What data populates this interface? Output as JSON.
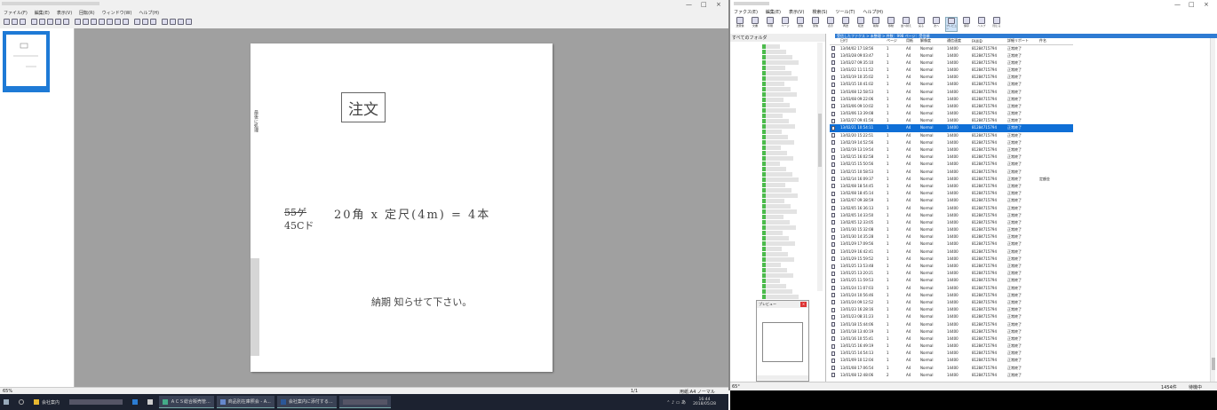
{
  "left_app": {
    "menu": [
      "ファイル(F)",
      "編集(E)",
      "表示(V)",
      "回転(R)",
      "ウィンドウ(W)",
      "ヘルプ(H)"
    ],
    "window_controls": [
      "—",
      "□",
      "×"
    ],
    "document": {
      "title": "注文",
      "side_note": "最後に処理",
      "struck": "55ゲ",
      "item": "45Cド",
      "line": "20角 x 定尺(4m) = 4本",
      "note": "納期 知らせて下さい。"
    },
    "status_zoom": "65%",
    "status_page": "1/1",
    "status_paper": "用紙:A4 ノーマル"
  },
  "taskbar": {
    "items": [
      {
        "label": "会社案内"
      },
      {
        "label": "ＡＣＳ総合販売管..."
      },
      {
        "label": "商品別在庫照会 - A..."
      },
      {
        "label": "会社案内に添付する..."
      }
    ],
    "time": "16:44",
    "date": "2018/05/28"
  },
  "right_app": {
    "menu": [
      "ファクス(E)",
      "編集(E)",
      "表示(V)",
      "検索(S)",
      "ツール(T)",
      "ヘルプ(H)"
    ],
    "window_controls": [
      "—",
      "□",
      "×"
    ],
    "toolbar": [
      "送受信",
      "文書",
      "印刷",
      "ページ",
      "送信",
      "受信",
      "表示",
      "再送",
      "転送",
      "削除",
      "移動",
      "並べ替え",
      "戻る",
      "次へ",
      "プレビュー",
      "保存",
      "ヘルプ",
      "閉じる"
    ],
    "tree_title": "すべてのフォルダ",
    "path": "受信したファクス > 未整理 > 件数：998 ページ：受信順",
    "preview_title": "プレビュー",
    "columns": [
      "日付",
      "ページ",
      "用紙",
      "解像度",
      "通信速度",
      "FAXID",
      "詳細リポート",
      "件名"
    ],
    "rows": [
      [
        "13/04/02 17:18:56",
        "1",
        "A4",
        "Normal",
        "14400",
        "81284715794",
        "正常終了",
        ""
      ],
      [
        "13/03/28 09:03:47",
        "1",
        "A4",
        "Normal",
        "14400",
        "81284715794",
        "正常終了",
        ""
      ],
      [
        "13/03/27 09:35:10",
        "1",
        "A4",
        "Normal",
        "14400",
        "81284715794",
        "正常終了",
        ""
      ],
      [
        "13/03/22 11:11:52",
        "1",
        "A4",
        "Normal",
        "14400",
        "81284715794",
        "正常終了",
        ""
      ],
      [
        "13/03/19 10:35:02",
        "1",
        "A4",
        "Normal",
        "14400",
        "81284715794",
        "正常終了",
        ""
      ],
      [
        "13/03/15 10:41:02",
        "1",
        "A4",
        "Normal",
        "14400",
        "81284715794",
        "正常終了",
        ""
      ],
      [
        "13/03/08 12:58:53",
        "1",
        "A4",
        "Normal",
        "14400",
        "81284715794",
        "正常終了",
        ""
      ],
      [
        "13/03/08 09:22:06",
        "1",
        "A4",
        "Normal",
        "14400",
        "81284715794",
        "正常終了",
        ""
      ],
      [
        "13/03/06 09:10:02",
        "1",
        "A4",
        "Normal",
        "14400",
        "81284715794",
        "正常終了",
        ""
      ],
      [
        "13/03/06 13:39:08",
        "1",
        "A4",
        "Normal",
        "14400",
        "81284715794",
        "正常終了",
        ""
      ],
      [
        "13/02/27 09:41:56",
        "1",
        "A4",
        "Normal",
        "14400",
        "81284715794",
        "正常終了",
        ""
      ],
      [
        "13/02/21 10:54:11",
        "1",
        "A4",
        "Normal",
        "14400",
        "81284715794",
        "正常終了",
        ""
      ],
      [
        "13/02/20 15:22:51",
        "1",
        "A4",
        "Normal",
        "14400",
        "81284715794",
        "正常終了",
        ""
      ],
      [
        "13/02/19 14:52:56",
        "1",
        "A4",
        "Normal",
        "14400",
        "81284715794",
        "正常終了",
        ""
      ],
      [
        "13/02/19 13:19:54",
        "1",
        "A4",
        "Normal",
        "14400",
        "81284715794",
        "正常終了",
        ""
      ],
      [
        "13/02/15 16:02:58",
        "1",
        "A4",
        "Normal",
        "14400",
        "81284715794",
        "正常終了",
        ""
      ],
      [
        "13/02/15 15:50:56",
        "1",
        "A4",
        "Normal",
        "14400",
        "81284715794",
        "正常終了",
        ""
      ],
      [
        "13/02/15 10:58:53",
        "1",
        "A4",
        "Normal",
        "14400",
        "81284715794",
        "正常終了",
        ""
      ],
      [
        "13/02/14 16:09:37",
        "1",
        "A4",
        "Normal",
        "14400",
        "81284715794",
        "正常終了",
        "定額金"
      ],
      [
        "13/02/08 18:54:45",
        "1",
        "A4",
        "Normal",
        "14400",
        "81284715794",
        "正常終了",
        ""
      ],
      [
        "13/02/08 18:45:14",
        "1",
        "A4",
        "Normal",
        "14400",
        "81284715794",
        "正常終了",
        ""
      ],
      [
        "13/02/07 09:38:59",
        "1",
        "A4",
        "Normal",
        "14400",
        "81284715794",
        "正常終了",
        ""
      ],
      [
        "13/02/05 16:36:13",
        "1",
        "A4",
        "Normal",
        "14400",
        "81284715794",
        "正常終了",
        ""
      ],
      [
        "13/02/05 14:33:50",
        "1",
        "A4",
        "Normal",
        "14400",
        "81284715794",
        "正常終了",
        ""
      ],
      [
        "13/02/05 12:33:05",
        "1",
        "A4",
        "Normal",
        "14400",
        "81284715794",
        "正常終了",
        ""
      ],
      [
        "13/01/30 15:32:08",
        "1",
        "A4",
        "Normal",
        "14400",
        "81284715794",
        "正常終了",
        ""
      ],
      [
        "13/01/30 14:35:28",
        "1",
        "A4",
        "Normal",
        "14400",
        "81284715794",
        "正常終了",
        ""
      ],
      [
        "13/01/29 17:09:56",
        "1",
        "A4",
        "Normal",
        "14400",
        "81284715794",
        "正常終了",
        ""
      ],
      [
        "13/01/29 16:42:41",
        "1",
        "A4",
        "Normal",
        "14400",
        "81284715794",
        "正常終了",
        ""
      ],
      [
        "13/01/29 15:59:52",
        "1",
        "A4",
        "Normal",
        "14400",
        "81284715794",
        "正常終了",
        ""
      ],
      [
        "13/01/25 13:53:48",
        "1",
        "A4",
        "Normal",
        "14400",
        "81284715794",
        "正常終了",
        ""
      ],
      [
        "13/01/25 13:20:21",
        "1",
        "A4",
        "Normal",
        "14400",
        "81284715794",
        "正常終了",
        ""
      ],
      [
        "13/01/25 11:59:53",
        "1",
        "A4",
        "Normal",
        "14400",
        "81284715794",
        "正常終了",
        ""
      ],
      [
        "13/01/24 11:07:03",
        "1",
        "A4",
        "Normal",
        "14400",
        "81284715794",
        "正常終了",
        ""
      ],
      [
        "13/01/24 10:56:46",
        "1",
        "A4",
        "Normal",
        "14400",
        "81284715794",
        "正常終了",
        ""
      ],
      [
        "13/01/24 09:12:52",
        "1",
        "A4",
        "Normal",
        "14400",
        "81284715794",
        "正常終了",
        ""
      ],
      [
        "13/01/23 16:28:16",
        "1",
        "A4",
        "Normal",
        "14400",
        "81284715794",
        "正常終了",
        ""
      ],
      [
        "13/01/23 08:31:23",
        "1",
        "A4",
        "Normal",
        "14400",
        "81284715794",
        "正常終了",
        ""
      ],
      [
        "13/01/18 15:44:06",
        "1",
        "A4",
        "Normal",
        "14400",
        "81284715794",
        "正常終了",
        ""
      ],
      [
        "13/01/18 13:40:19",
        "1",
        "A4",
        "Normal",
        "14400",
        "81284715794",
        "正常終了",
        ""
      ],
      [
        "13/01/16 10:55:41",
        "1",
        "A4",
        "Normal",
        "14400",
        "81284715794",
        "正常終了",
        ""
      ],
      [
        "13/01/15 16:49:19",
        "1",
        "A4",
        "Normal",
        "14400",
        "81284715794",
        "正常終了",
        ""
      ],
      [
        "13/01/15 14:54:13",
        "1",
        "A4",
        "Normal",
        "14400",
        "81284715794",
        "正常終了",
        ""
      ],
      [
        "13/01/09 10:12:04",
        "1",
        "A4",
        "Normal",
        "14400",
        "81284715794",
        "正常終了",
        ""
      ],
      [
        "13/01/08 17:06:54",
        "1",
        "A4",
        "Normal",
        "14400",
        "81284715794",
        "正常終了",
        ""
      ],
      [
        "13/01/08 12:48:06",
        "2",
        "A4",
        "Normal",
        "14400",
        "81284715794",
        "正常終了",
        ""
      ]
    ],
    "selected_index": 11,
    "status_zoom": "65°",
    "status_left": "1454件",
    "status_right": "待機中"
  }
}
